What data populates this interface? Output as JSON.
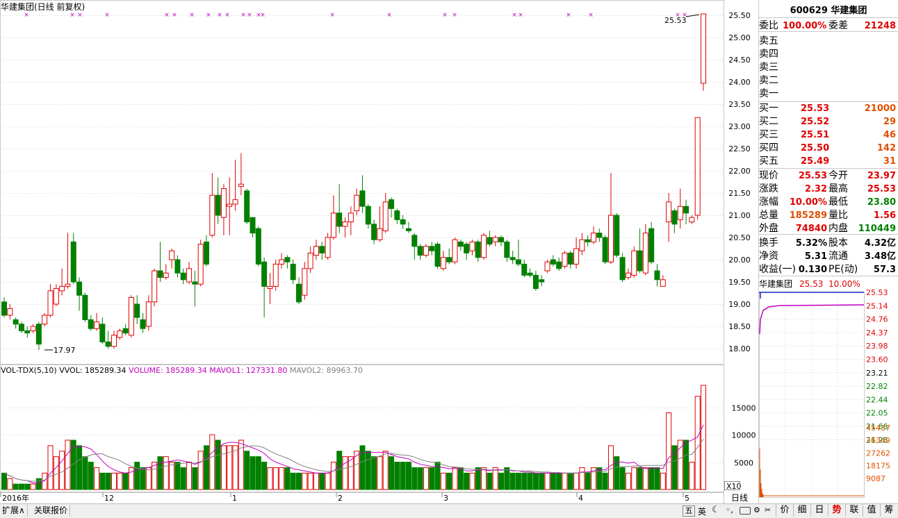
{
  "chart_title": "华建集团(日线 前复权)",
  "price_axis": [
    "25.50",
    "25.00",
    "24.50",
    "24.00",
    "23.50",
    "23.00",
    "22.50",
    "22.00",
    "21.50",
    "21.00",
    "20.50",
    "20.00",
    "19.50",
    "19.00",
    "18.50",
    "18.00"
  ],
  "price_high_label": "25.53",
  "price_low_label": "17.97",
  "volume_header": {
    "name": "VOL-TDX(5,10)",
    "vvol": "VVOL: 185289.34",
    "volume": "VOLUME: 185289.34",
    "mavol1": "MAVOL1: 127331.80",
    "mavol2": "MAVOL2: 89963.70"
  },
  "volume_axis": [
    "15000",
    "10000",
    "5000"
  ],
  "volume_unit": "X10",
  "date_axis": [
    "2016年",
    "12",
    "1",
    "2",
    "3",
    "4",
    "5"
  ],
  "period_label": "日线",
  "quote": {
    "code_name": "600629 华建集团",
    "weibi_label": "委比",
    "weibi": "100.00%",
    "weicha_label": "委差",
    "weicha": "21248",
    "sell": [
      "卖五",
      "卖四",
      "卖三",
      "卖二",
      "卖一"
    ],
    "buy": [
      {
        "label": "买一",
        "price": "25.53",
        "vol": "21000"
      },
      {
        "label": "买二",
        "price": "25.52",
        "vol": "29"
      },
      {
        "label": "买三",
        "price": "25.51",
        "vol": "46"
      },
      {
        "label": "买四",
        "price": "25.50",
        "vol": "142"
      },
      {
        "label": "买五",
        "price": "25.49",
        "vol": "31"
      }
    ],
    "stats": [
      {
        "l1": "现价",
        "v1": "25.53",
        "l2": "今开",
        "v2": "23.97"
      },
      {
        "l1": "涨跌",
        "v1": "2.32",
        "l2": "最高",
        "v2": "25.53"
      },
      {
        "l1": "涨幅",
        "v1": "10.00%",
        "l2": "最低",
        "v2": "23.80"
      },
      {
        "l1": "总量",
        "v1": "185289",
        "l2": "量比",
        "v2": "1.56"
      },
      {
        "l1": "外盘",
        "v1": "74840",
        "l2": "内盘",
        "v2": "110449"
      }
    ],
    "fin": [
      {
        "l1": "换手",
        "v1": "5.32%",
        "l2": "股本",
        "v2": "4.32亿"
      },
      {
        "l1": "净资",
        "v1": "5.31",
        "l2": "流通",
        "v2": "3.48亿"
      },
      {
        "l1": "收益(一)",
        "v1": "0.130",
        "l2": "PE(动)",
        "v2": "57.3"
      }
    ]
  },
  "mini": {
    "title": "华建集团",
    "price": "25.53",
    "pct": "10.00%",
    "price_axis": [
      "25.53",
      "25.14",
      "24.76",
      "24.37",
      "23.98",
      "23.60",
      "23.21",
      "22.82",
      "22.44",
      "22.05",
      "21.66",
      "21.28"
    ],
    "vol_axis": [
      "45437",
      "36349",
      "27262",
      "18175",
      "9087"
    ]
  },
  "bottom_buttons": [
    "扩展∧",
    "关联报价"
  ],
  "bottom_tabs": [
    "价",
    "细",
    "日",
    "势",
    "联",
    "值",
    "筹"
  ],
  "colors": {
    "up": "#e00000",
    "down": "#008000",
    "ma1": "#c000c0",
    "ma2": "#808080"
  },
  "chart_data": {
    "type": "candlestick",
    "title": "华建集团(日线 前复权)",
    "ylim": [
      17.8,
      25.7
    ],
    "candles": [
      [
        19.05,
        18.75,
        19.15,
        18.7
      ],
      [
        18.75,
        18.9,
        19.0,
        18.65
      ],
      [
        18.65,
        18.55,
        18.7,
        18.45
      ],
      [
        18.55,
        18.4,
        18.6,
        18.35
      ],
      [
        18.4,
        18.35,
        18.5,
        18.25
      ],
      [
        18.4,
        18.5,
        18.55,
        18.35
      ],
      [
        18.55,
        18.1,
        18.6,
        17.97
      ],
      [
        18.55,
        18.75,
        18.8,
        18.5
      ],
      [
        18.75,
        19.3,
        19.45,
        18.7
      ],
      [
        19.0,
        19.35,
        19.45,
        18.95
      ],
      [
        19.3,
        19.4,
        19.8,
        19.2
      ],
      [
        19.4,
        19.45,
        20.6,
        19.35
      ],
      [
        20.4,
        19.5,
        20.6,
        19.45
      ],
      [
        19.5,
        19.2,
        19.6,
        18.85
      ],
      [
        19.2,
        18.65,
        19.25,
        18.6
      ],
      [
        18.65,
        18.45,
        18.75,
        18.4
      ],
      [
        18.45,
        18.6,
        18.8,
        18.4
      ],
      [
        18.55,
        18.15,
        18.7,
        18.1
      ],
      [
        18.15,
        18.05,
        18.4,
        18.0
      ],
      [
        18.05,
        18.3,
        18.4,
        18.0
      ],
      [
        18.25,
        18.4,
        18.45,
        18.2
      ],
      [
        18.45,
        18.35,
        18.55,
        18.3
      ],
      [
        18.3,
        19.15,
        19.2,
        18.25
      ],
      [
        19.0,
        18.7,
        19.2,
        18.55
      ],
      [
        18.65,
        18.45,
        18.8,
        18.35
      ],
      [
        18.5,
        19.05,
        19.2,
        18.4
      ],
      [
        19.05,
        19.75,
        19.8,
        18.95
      ],
      [
        19.75,
        19.6,
        20.4,
        19.5
      ],
      [
        19.6,
        19.7,
        19.9,
        19.55
      ],
      [
        20.0,
        20.2,
        20.25,
        19.8
      ],
      [
        20.0,
        19.7,
        20.1,
        19.6
      ],
      [
        19.7,
        19.55,
        19.8,
        19.45
      ],
      [
        19.5,
        19.8,
        19.95,
        19.45
      ],
      [
        19.5,
        19.45,
        19.75,
        18.95
      ],
      [
        19.45,
        20.35,
        20.45,
        19.4
      ],
      [
        20.4,
        19.9,
        20.55,
        19.85
      ],
      [
        20.55,
        21.45,
        21.95,
        20.5
      ],
      [
        21.45,
        21.0,
        21.85,
        20.8
      ],
      [
        20.95,
        21.6,
        21.7,
        20.55
      ],
      [
        21.2,
        21.25,
        21.85,
        20.55
      ],
      [
        21.25,
        21.35,
        22.25,
        21.1
      ],
      [
        21.65,
        21.7,
        22.4,
        21.45
      ],
      [
        21.55,
        20.85,
        21.6,
        20.8
      ],
      [
        20.95,
        20.6,
        20.95,
        20.5
      ],
      [
        20.7,
        19.9,
        20.75,
        19.85
      ],
      [
        19.95,
        19.4,
        20.05,
        18.7
      ],
      [
        19.35,
        19.4,
        19.7,
        19.0
      ],
      [
        19.4,
        19.9,
        20.0,
        19.3
      ],
      [
        19.9,
        20.0,
        20.15,
        19.8
      ],
      [
        20.05,
        19.95,
        20.1,
        19.8
      ],
      [
        19.9,
        19.55,
        20.0,
        19.45
      ],
      [
        19.45,
        19.05,
        19.6,
        19.0
      ],
      [
        19.2,
        19.8,
        19.95,
        19.1
      ],
      [
        19.8,
        20.15,
        20.3,
        19.7
      ],
      [
        20.1,
        20.3,
        20.45,
        20.0
      ],
      [
        20.3,
        20.15,
        20.4,
        20.0
      ],
      [
        20.05,
        20.5,
        20.6,
        20.0
      ],
      [
        20.5,
        21.05,
        21.45,
        20.45
      ],
      [
        21.05,
        20.75,
        21.7,
        20.6
      ],
      [
        20.75,
        20.85,
        20.95,
        20.5
      ],
      [
        20.85,
        21.05,
        21.2,
        20.55
      ],
      [
        21.1,
        21.45,
        21.6,
        21.0
      ],
      [
        21.55,
        21.2,
        21.9,
        21.05
      ],
      [
        21.2,
        20.8,
        21.25,
        20.7
      ],
      [
        20.8,
        20.45,
        20.9,
        20.35
      ],
      [
        20.45,
        20.7,
        21.2,
        20.4
      ],
      [
        20.65,
        21.3,
        21.5,
        20.6
      ],
      [
        21.35,
        21.15,
        21.4,
        20.95
      ],
      [
        21.1,
        20.9,
        21.15,
        20.8
      ],
      [
        20.9,
        20.8,
        21.0,
        20.7
      ],
      [
        20.7,
        20.65,
        20.85,
        20.6
      ],
      [
        20.55,
        20.3,
        20.6,
        20.0
      ],
      [
        20.3,
        20.1,
        20.35,
        20.0
      ],
      [
        20.1,
        20.3,
        20.35,
        20.05
      ],
      [
        20.3,
        20.2,
        20.4,
        20.1
      ],
      [
        20.35,
        19.85,
        20.4,
        19.8
      ],
      [
        19.8,
        20.05,
        20.2,
        19.75
      ],
      [
        20.05,
        19.95,
        20.25,
        19.9
      ],
      [
        19.95,
        20.45,
        20.5,
        19.9
      ],
      [
        20.4,
        20.3,
        20.45,
        20.2
      ],
      [
        20.35,
        20.15,
        20.4,
        20.0
      ],
      [
        20.2,
        20.4,
        20.45,
        20.1
      ],
      [
        20.4,
        20.05,
        20.45,
        19.95
      ],
      [
        20.05,
        20.55,
        20.6,
        20.0
      ],
      [
        20.5,
        20.35,
        20.65,
        20.3
      ],
      [
        20.4,
        20.5,
        20.55,
        20.3
      ],
      [
        20.5,
        20.4,
        20.55,
        20.3
      ],
      [
        20.4,
        20.05,
        20.45,
        19.95
      ],
      [
        20.05,
        20.0,
        20.2,
        19.9
      ],
      [
        20.0,
        19.9,
        20.45,
        19.85
      ],
      [
        19.9,
        19.65,
        20.0,
        19.6
      ],
      [
        19.7,
        19.65,
        19.8,
        19.6
      ],
      [
        19.65,
        19.35,
        19.75,
        19.3
      ],
      [
        19.55,
        19.5,
        19.65,
        19.4
      ],
      [
        19.75,
        19.95,
        20.0,
        19.7
      ],
      [
        20.0,
        19.9,
        20.1,
        19.85
      ],
      [
        19.95,
        19.8,
        20.05,
        19.75
      ],
      [
        19.85,
        20.15,
        20.2,
        19.8
      ],
      [
        20.15,
        19.9,
        20.2,
        19.8
      ],
      [
        19.9,
        20.25,
        20.5,
        19.8
      ],
      [
        20.2,
        20.45,
        20.6,
        20.1
      ],
      [
        20.45,
        20.4,
        20.55,
        20.3
      ],
      [
        20.4,
        20.6,
        20.75,
        20.35
      ],
      [
        20.6,
        20.5,
        20.7,
        20.4
      ],
      [
        20.5,
        19.95,
        20.55,
        19.9
      ],
      [
        19.95,
        21.0,
        21.95,
        19.9
      ],
      [
        21.0,
        20.1,
        21.05,
        20.05
      ],
      [
        20.05,
        19.55,
        20.15,
        19.5
      ],
      [
        19.6,
        19.7,
        19.8,
        19.55
      ],
      [
        19.65,
        20.2,
        20.3,
        19.6
      ],
      [
        20.2,
        19.75,
        20.7,
        19.7
      ],
      [
        19.7,
        20.6,
        20.8,
        19.65
      ],
      [
        20.7,
        19.95,
        20.85,
        19.9
      ],
      [
        19.75,
        19.55,
        19.9,
        19.4
      ],
      [
        19.4,
        19.55,
        19.65,
        19.4
      ],
      [
        20.85,
        21.3,
        21.5,
        20.4
      ],
      [
        21.1,
        20.8,
        21.15,
        20.6
      ],
      [
        20.9,
        21.2,
        21.6,
        20.7
      ],
      [
        21.2,
        21.05,
        21.35,
        20.8
      ],
      [
        20.85,
        20.95,
        21.0,
        20.8
      ],
      [
        21.0,
        23.2,
        23.2,
        20.9
      ],
      [
        23.97,
        25.53,
        25.53,
        23.8
      ]
    ],
    "volume": [
      3,
      2,
      1,
      1,
      1,
      1,
      2,
      3,
      8,
      6,
      7,
      9,
      9,
      8,
      6,
      5,
      4,
      3,
      3,
      3,
      3,
      3,
      4,
      5,
      4,
      4,
      5,
      6,
      6,
      5,
      5,
      4,
      5,
      4,
      7,
      8,
      10,
      9,
      8,
      8,
      8,
      9,
      7,
      6,
      6,
      5,
      4,
      4,
      4,
      4,
      3,
      3,
      3,
      3,
      3,
      3,
      3,
      5,
      7,
      6,
      6,
      7,
      8,
      7,
      6,
      6,
      7,
      6,
      5,
      5,
      5,
      4,
      4,
      4,
      4,
      5,
      3,
      3,
      4,
      4,
      3,
      3,
      4,
      4,
      3,
      4,
      3,
      4,
      3,
      3,
      3,
      3,
      3,
      3,
      3,
      3,
      3,
      3,
      3,
      3,
      4,
      3,
      4,
      4,
      3,
      8,
      6,
      4,
      3,
      4,
      4,
      4,
      4,
      4,
      3,
      14,
      8,
      9,
      9,
      5,
      17,
      19
    ]
  }
}
